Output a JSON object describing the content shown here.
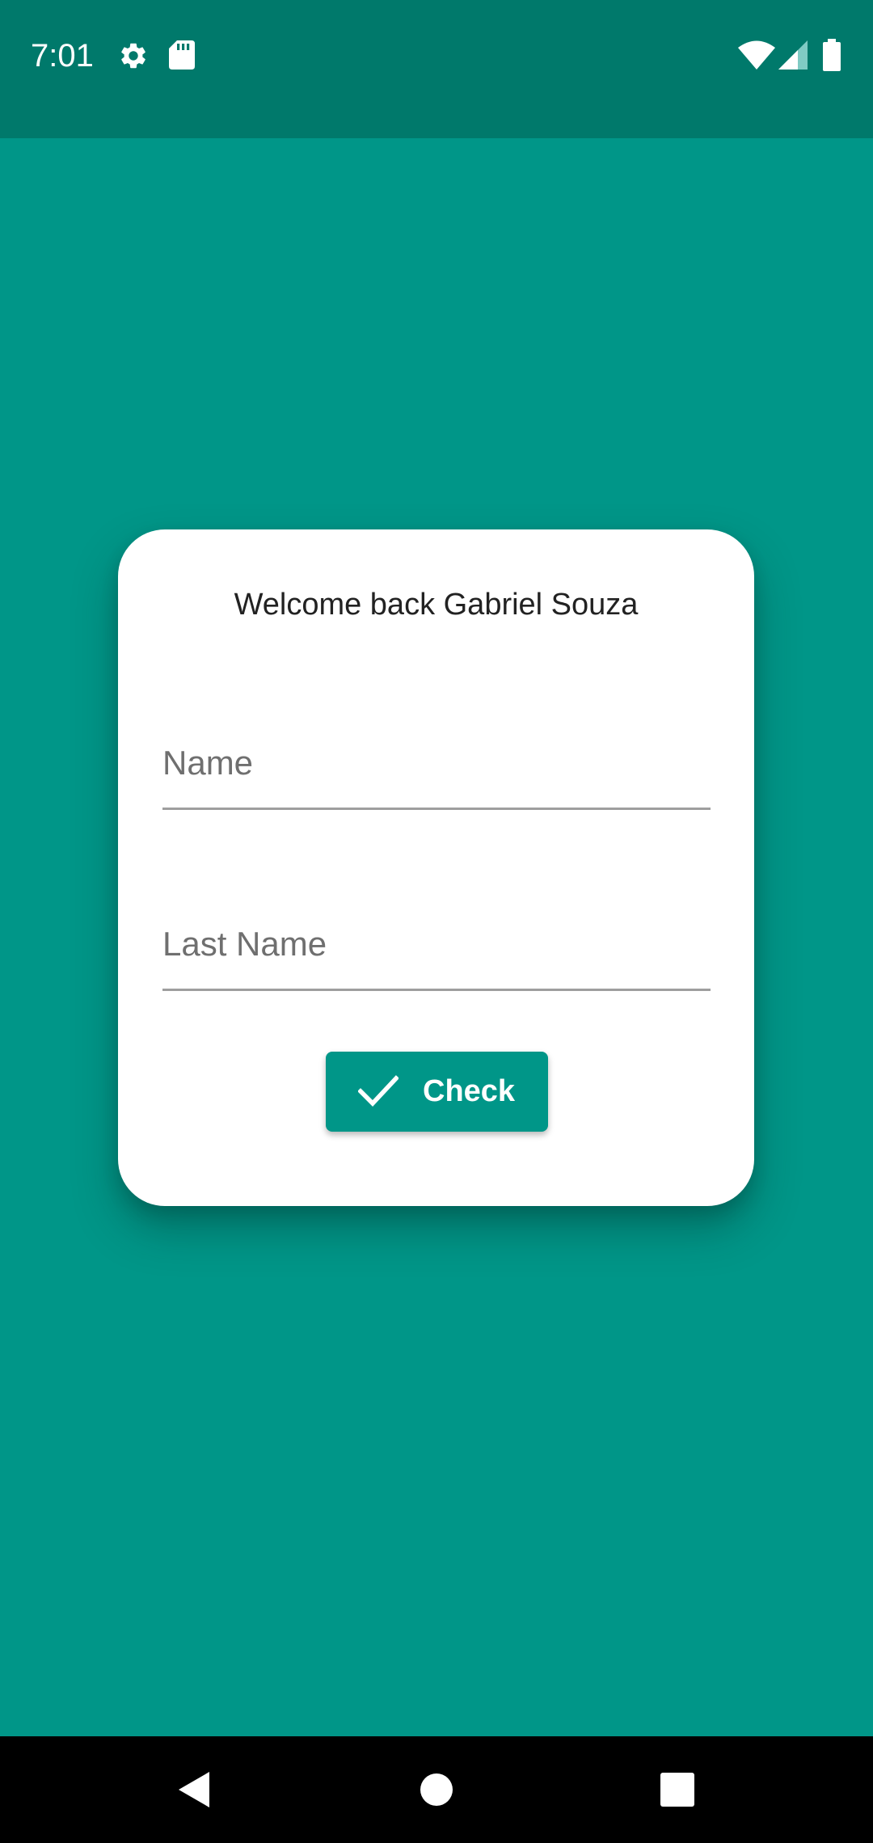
{
  "status_bar": {
    "time": "7:01",
    "left_icons": [
      "gear-icon",
      "sdcard-icon"
    ],
    "right_icons": [
      "wifi-icon",
      "signal-icon",
      "battery-icon"
    ]
  },
  "card": {
    "welcome_text": "Welcome back Gabriel Souza",
    "name_field": {
      "placeholder": "Name",
      "value": ""
    },
    "last_name_field": {
      "placeholder": "Last Name",
      "value": ""
    },
    "check_button": {
      "label": "Check",
      "icon": "check-icon"
    }
  },
  "nav_bar": {
    "buttons": [
      "back-icon",
      "home-icon",
      "recents-icon"
    ]
  },
  "colors": {
    "background": "#009688",
    "status_bar": "#00796B",
    "card": "#FFFFFF",
    "button": "#009688",
    "nav_bar": "#000000"
  }
}
